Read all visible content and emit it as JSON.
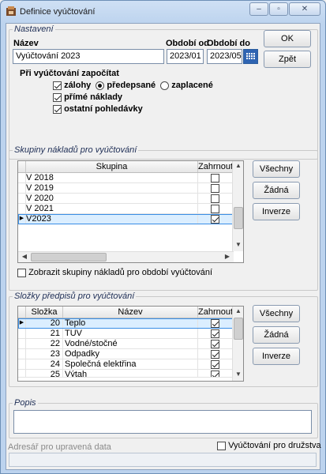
{
  "window": {
    "title": "Definice vyúčtování",
    "buttons": [
      "‒",
      "▫",
      "✕"
    ]
  },
  "nastaveni": {
    "legend": "Nastavení",
    "nazev_label": "Název",
    "nazev_value": "Vyúčtování 2023",
    "obdobi_od_label": "Období od",
    "obdobi_od_value": "2023/01",
    "obdobi_do_label": "Období do",
    "obdobi_do_value": "2023/05",
    "ok_label": "OK",
    "zpet_label": "Zpět",
    "pri_label": "Při vyúčtování započítat",
    "zalohy_label": "zálohy",
    "predepsane_label": "předepsané",
    "zaplacene_label": "zaplacené",
    "prime_label": "přímé náklady",
    "ostatni_label": "ostatní pohledávky"
  },
  "skupiny": {
    "legend": "Skupiny nákladů pro vyúčtování",
    "col_skupina": "Skupina",
    "col_zahrnout": "Zahrnout",
    "rows": [
      {
        "name": "V 2018",
        "checked": false
      },
      {
        "name": "V 2019",
        "checked": false
      },
      {
        "name": "V 2020",
        "checked": false
      },
      {
        "name": "V 2021",
        "checked": false
      },
      {
        "name": "V2023",
        "checked": true
      }
    ],
    "vsechny_label": "Všechny",
    "zadna_label": "Žádná",
    "inverze_label": "Inverze",
    "zobrazit_label": "Zobrazit skupiny nákladů pro období vyúčtování"
  },
  "slozky": {
    "legend": "Složky předpisů pro vyúčtování",
    "col_slozka": "Složka",
    "col_nazev": "Název",
    "col_zahrnout": "Zahrnout",
    "rows": [
      {
        "num": "20",
        "name": "Teplo",
        "checked": true
      },
      {
        "num": "21",
        "name": "TUV",
        "checked": true
      },
      {
        "num": "22",
        "name": "Vodné/stočné",
        "checked": true
      },
      {
        "num": "23",
        "name": "Odpadky",
        "checked": true
      },
      {
        "num": "24",
        "name": "Společná elektřina",
        "checked": true
      },
      {
        "num": "25",
        "name": "Výtah",
        "checked": true
      }
    ],
    "vsechny_label": "Všechny",
    "zadna_label": "Žádná",
    "inverze_label": "Inverze"
  },
  "popis": {
    "legend": "Popis",
    "value": ""
  },
  "adresar": {
    "label": "Adresář pro upravená data",
    "value": "",
    "druzstvo_label": "Vyúčtování pro družstva"
  }
}
